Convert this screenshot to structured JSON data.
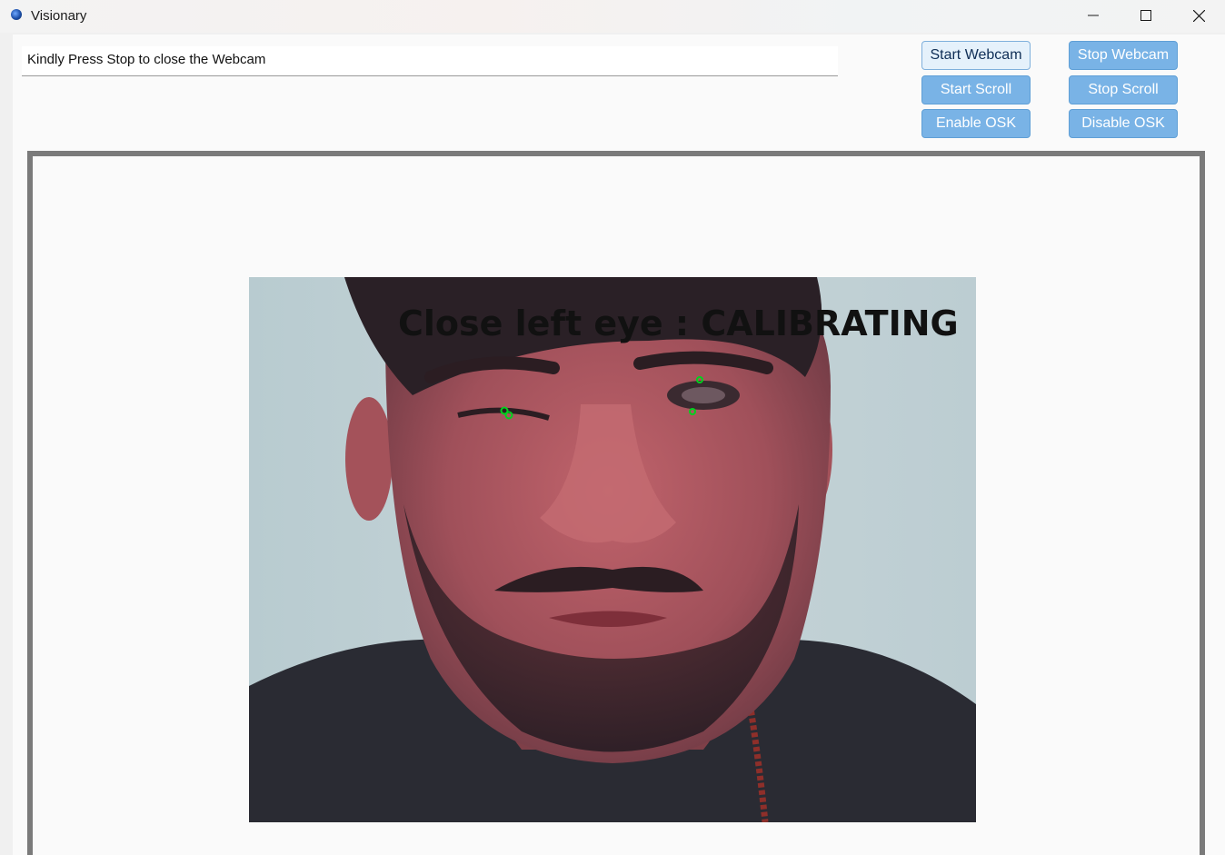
{
  "window": {
    "title": "Visionary"
  },
  "status": {
    "message": "Kindly Press Stop to close the Webcam"
  },
  "buttons": {
    "start_webcam": "Start Webcam",
    "stop_webcam": "Stop Webcam",
    "start_scroll": "Start Scroll",
    "stop_scroll": "Stop Scroll",
    "enable_osk": "Enable OSK",
    "disable_osk": "Disable OSK"
  },
  "webcam": {
    "overlay_text": "Close  left  eye  :  CALIBRATING",
    "landmark_color": "#00d21e"
  },
  "colors": {
    "button_fill": "#79b3e6",
    "button_active_fill": "#e5f1fb",
    "frame_border": "#7a7a7a"
  }
}
